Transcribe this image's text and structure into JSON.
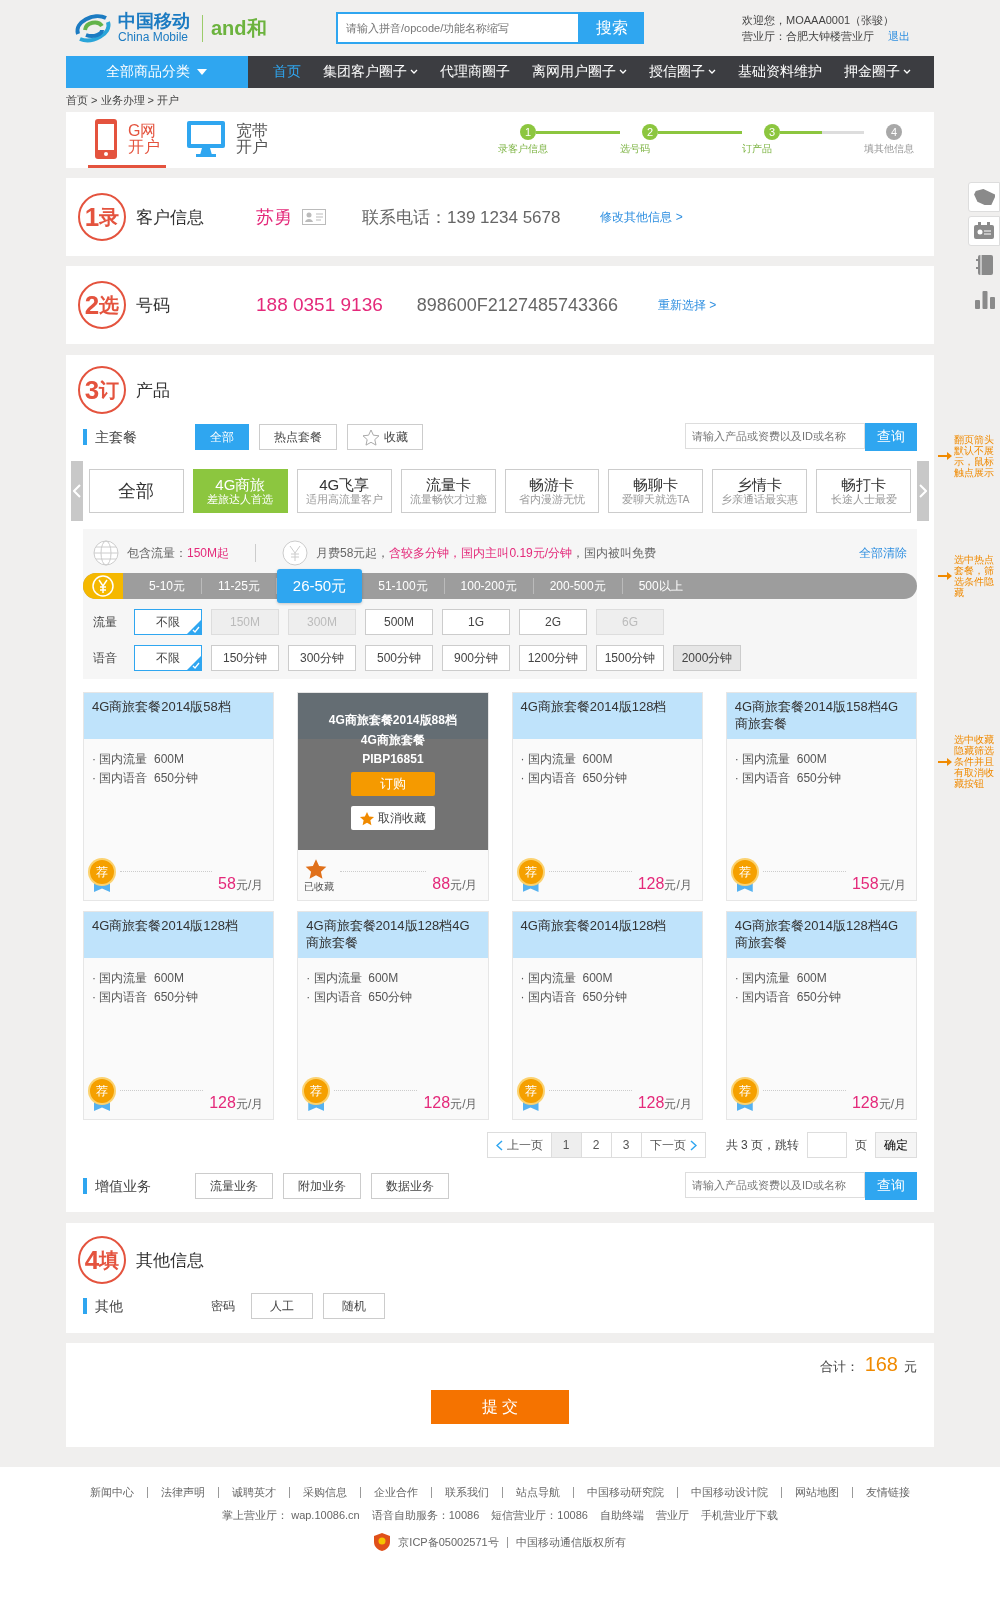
{
  "header": {
    "logo_cn": "中国移动",
    "logo_en": "China Mobile",
    "brand_logo": {
      "latin": "and",
      "cn": "和"
    },
    "search": {
      "placeholder": "请输入拼音/opcode/功能名称缩写",
      "button": "搜索"
    },
    "welcome": "欢迎您，MOAAA0001（张骏）",
    "hall": "营业厅：合肥大钟楼营业厅",
    "logout": "退出"
  },
  "nav": {
    "category_button": "全部商品分类",
    "items": [
      {
        "label": "首页",
        "selected": true,
        "dropdown": false
      },
      {
        "label": "集团客户圈子",
        "selected": false,
        "dropdown": true
      },
      {
        "label": "代理商圈子",
        "selected": false,
        "dropdown": false
      },
      {
        "label": "离网用户圈子",
        "selected": false,
        "dropdown": true
      },
      {
        "label": "授信圈子",
        "selected": false,
        "dropdown": true
      },
      {
        "label": "基础资料维护",
        "selected": false,
        "dropdown": false
      },
      {
        "label": "押金圈子",
        "selected": false,
        "dropdown": true
      }
    ]
  },
  "breadcrumb": "首页 > 业务办理 > 开户",
  "open_tabs": [
    {
      "kind": "phone",
      "line1": "G网",
      "line2": "开户",
      "selected": true
    },
    {
      "kind": "monitor",
      "line1": "宽带",
      "line2": "开户",
      "selected": false
    }
  ],
  "steps": [
    {
      "number": "1",
      "label": "录客户信息",
      "done": true
    },
    {
      "number": "2",
      "label": "选号码",
      "done": true
    },
    {
      "number": "3",
      "label": "订产品",
      "done": true
    },
    {
      "number": "4",
      "label": "填其他信息",
      "done": false
    }
  ],
  "customer": {
    "badge_number": "1",
    "badge_char": "录",
    "title": "客户信息",
    "name": "苏勇",
    "phone": "联系电话：139 1234 5678",
    "link": "修改其他信息 >"
  },
  "number": {
    "badge_number": "2",
    "badge_char": "选",
    "title": "号码",
    "phone_number": "188 0351 9136",
    "sim": "898600F2127485743366",
    "link": "重新选择 >"
  },
  "product": {
    "badge_number": "3",
    "badge_char": "订",
    "title": "产品",
    "main": {
      "label": "主套餐",
      "filters": [
        {
          "label": "全部",
          "selected": true,
          "kind": "plain"
        },
        {
          "label": "热点套餐",
          "selected": false,
          "kind": "plain"
        },
        {
          "label": "收藏",
          "selected": false,
          "kind": "star"
        }
      ],
      "search": {
        "placeholder": "请输入产品或资费以及ID或名称",
        "button": "查询"
      }
    },
    "categories": [
      {
        "name": "全部",
        "selected": false
      },
      {
        "name": "4G商旅",
        "sub": "差旅达人首选",
        "selected": true
      },
      {
        "name": "4G飞享",
        "sub": "适用高流量客户",
        "selected": false
      },
      {
        "name": "流量卡",
        "sub": "流量畅饮才过瘾",
        "selected": false
      },
      {
        "name": "畅游卡",
        "sub": "省内漫游无忧",
        "selected": false
      },
      {
        "name": "畅聊卡",
        "sub": "爱聊天就选TA",
        "selected": false
      },
      {
        "name": "乡情卡",
        "sub": "乡亲通话最实惠",
        "selected": false
      },
      {
        "name": "畅打卡",
        "sub": "长途人士最爱",
        "selected": false
      }
    ],
    "summary": {
      "data_label": "包含流量：",
      "data_value": "150M起",
      "fee": [
        {
          "text": "月费58元起，",
          "highlight": false
        },
        {
          "text": "含较多分钟，国内主叫0.19元/分钟",
          "highlight": true
        },
        {
          "text": "，国内被叫免费",
          "highlight": false
        }
      ],
      "clear": "全部清除"
    },
    "price_ranges": [
      {
        "label": "5-10元",
        "selected": false
      },
      {
        "label": "11-25元",
        "selected": false
      },
      {
        "label": "26-50元",
        "selected": true
      },
      {
        "label": "51-100元",
        "selected": false
      },
      {
        "label": "100-200元",
        "selected": false
      },
      {
        "label": "200-500元",
        "selected": false
      },
      {
        "label": "500以上",
        "selected": false
      }
    ],
    "option_rows": [
      {
        "label": "流量",
        "options": [
          {
            "label": "不限",
            "selected": true,
            "disabled": false,
            "hovered": false
          },
          {
            "label": "150M",
            "selected": false,
            "disabled": true,
            "hovered": false
          },
          {
            "label": "300M",
            "selected": false,
            "disabled": true,
            "hovered": false
          },
          {
            "label": "500M",
            "selected": false,
            "disabled": false,
            "hovered": false
          },
          {
            "label": "1G",
            "selected": false,
            "disabled": false,
            "hovered": false
          },
          {
            "label": "2G",
            "selected": false,
            "disabled": false,
            "hovered": false
          },
          {
            "label": "6G",
            "selected": false,
            "disabled": true,
            "hovered": false
          }
        ]
      },
      {
        "label": "语音",
        "options": [
          {
            "label": "不限",
            "selected": true,
            "disabled": false,
            "hovered": false
          },
          {
            "label": "150分钟",
            "selected": false,
            "disabled": false,
            "hovered": false
          },
          {
            "label": "300分钟",
            "selected": false,
            "disabled": false,
            "hovered": false
          },
          {
            "label": "500分钟",
            "selected": false,
            "disabled": false,
            "hovered": false
          },
          {
            "label": "900分钟",
            "selected": false,
            "disabled": false,
            "hovered": false
          },
          {
            "label": "1200分钟",
            "selected": false,
            "disabled": false,
            "hovered": false
          },
          {
            "label": "1500分钟",
            "selected": false,
            "disabled": false,
            "hovered": false
          },
          {
            "label": "2000分钟",
            "selected": false,
            "disabled": false,
            "hovered": true
          }
        ]
      }
    ],
    "cards": [
      {
        "title": "4G商旅套餐2014版58档",
        "features": [
          "· 国内流量  600M",
          "· 国内语音  650分钟"
        ],
        "badge": "荐",
        "favorited": false,
        "price": "58",
        "unit": "元/月"
      },
      {
        "favorited": true,
        "favorited_label": "已收藏",
        "price": "88",
        "unit": "元/月",
        "overlay": {
          "name": "4G商旅套餐2014版88档",
          "name2": "4G商旅套餐",
          "code": "PIBP16851",
          "buy": "订购",
          "unfavorite": "取消收藏"
        }
      },
      {
        "title": "4G商旅套餐2014版128档",
        "features": [
          "· 国内流量  600M",
          "· 国内语音  650分钟"
        ],
        "badge": "荐",
        "favorited": false,
        "price": "128",
        "unit": "元/月"
      },
      {
        "title": "4G商旅套餐2014版158档4G商旅套餐",
        "features": [
          "· 国内流量  600M",
          "· 国内语音  650分钟"
        ],
        "badge": "荐",
        "favorited": false,
        "price": "158",
        "unit": "元/月"
      },
      {
        "title": "4G商旅套餐2014版128档",
        "features": [
          "· 国内流量  600M",
          "· 国内语音  650分钟"
        ],
        "badge": "荐",
        "favorited": false,
        "price": "128",
        "unit": "元/月"
      },
      {
        "title": "4G商旅套餐2014版128档4G商旅套餐",
        "features": [
          "· 国内流量  600M",
          "· 国内语音  650分钟"
        ],
        "badge": "荐",
        "favorited": false,
        "price": "128",
        "unit": "元/月"
      },
      {
        "title": "4G商旅套餐2014版128档",
        "features": [
          "· 国内流量  600M",
          "· 国内语音  650分钟"
        ],
        "badge": "荐",
        "favorited": false,
        "price": "128",
        "unit": "元/月"
      },
      {
        "title": "4G商旅套餐2014版128档4G商旅套餐",
        "features": [
          "· 国内流量  600M",
          "· 国内语音  650分钟"
        ],
        "badge": "荐",
        "favorited": false,
        "price": "128",
        "unit": "元/月"
      }
    ],
    "pagination": {
      "prev": "上一页",
      "pages": [
        {
          "label": "1",
          "selected": true
        },
        {
          "label": "2",
          "selected": false
        },
        {
          "label": "3",
          "selected": false
        }
      ],
      "next": "下一页",
      "total": "共 3 页，跳转",
      "unit": "页",
      "confirm": "确定"
    },
    "value_added": {
      "label": "增值业务",
      "buttons": [
        "流量业务",
        "附加业务",
        "数据业务"
      ],
      "search": {
        "placeholder": "请输入产品或资费以及ID或名称",
        "button": "查询"
      }
    }
  },
  "other": {
    "badge_number": "4",
    "badge_char": "填",
    "title": "其他信息",
    "label": "其他",
    "field_label": "密码",
    "options": [
      {
        "label": "人工",
        "selected": false
      },
      {
        "label": "随机",
        "selected": false
      }
    ]
  },
  "total": {
    "label": "合计：",
    "amount": "168",
    "unit": "元",
    "submit": "提 交"
  },
  "annotations": [
    "翻页箭头默认不展示，鼠标触点展示",
    "选中热点套餐，筛选条件隐藏",
    "选中收藏隐藏筛选条件并且有取消收藏按钮"
  ],
  "footer": {
    "links": [
      "新闻中心",
      "法律声明",
      "诚聘英才",
      "采购信息",
      "企业合作",
      "联系我们",
      "站点导航",
      "中国移动研究院",
      "中国移动设计院",
      "网站地图",
      "友情链接"
    ],
    "services": [
      "掌上营业厅： wap.10086.cn",
      "语音自助服务：10086",
      "短信营业厅：10086",
      "自助终端",
      "营业厅",
      "手机营业厅下载"
    ],
    "icp": "京ICP备05002571号",
    "copyright": "中国移动通信版权所有"
  }
}
